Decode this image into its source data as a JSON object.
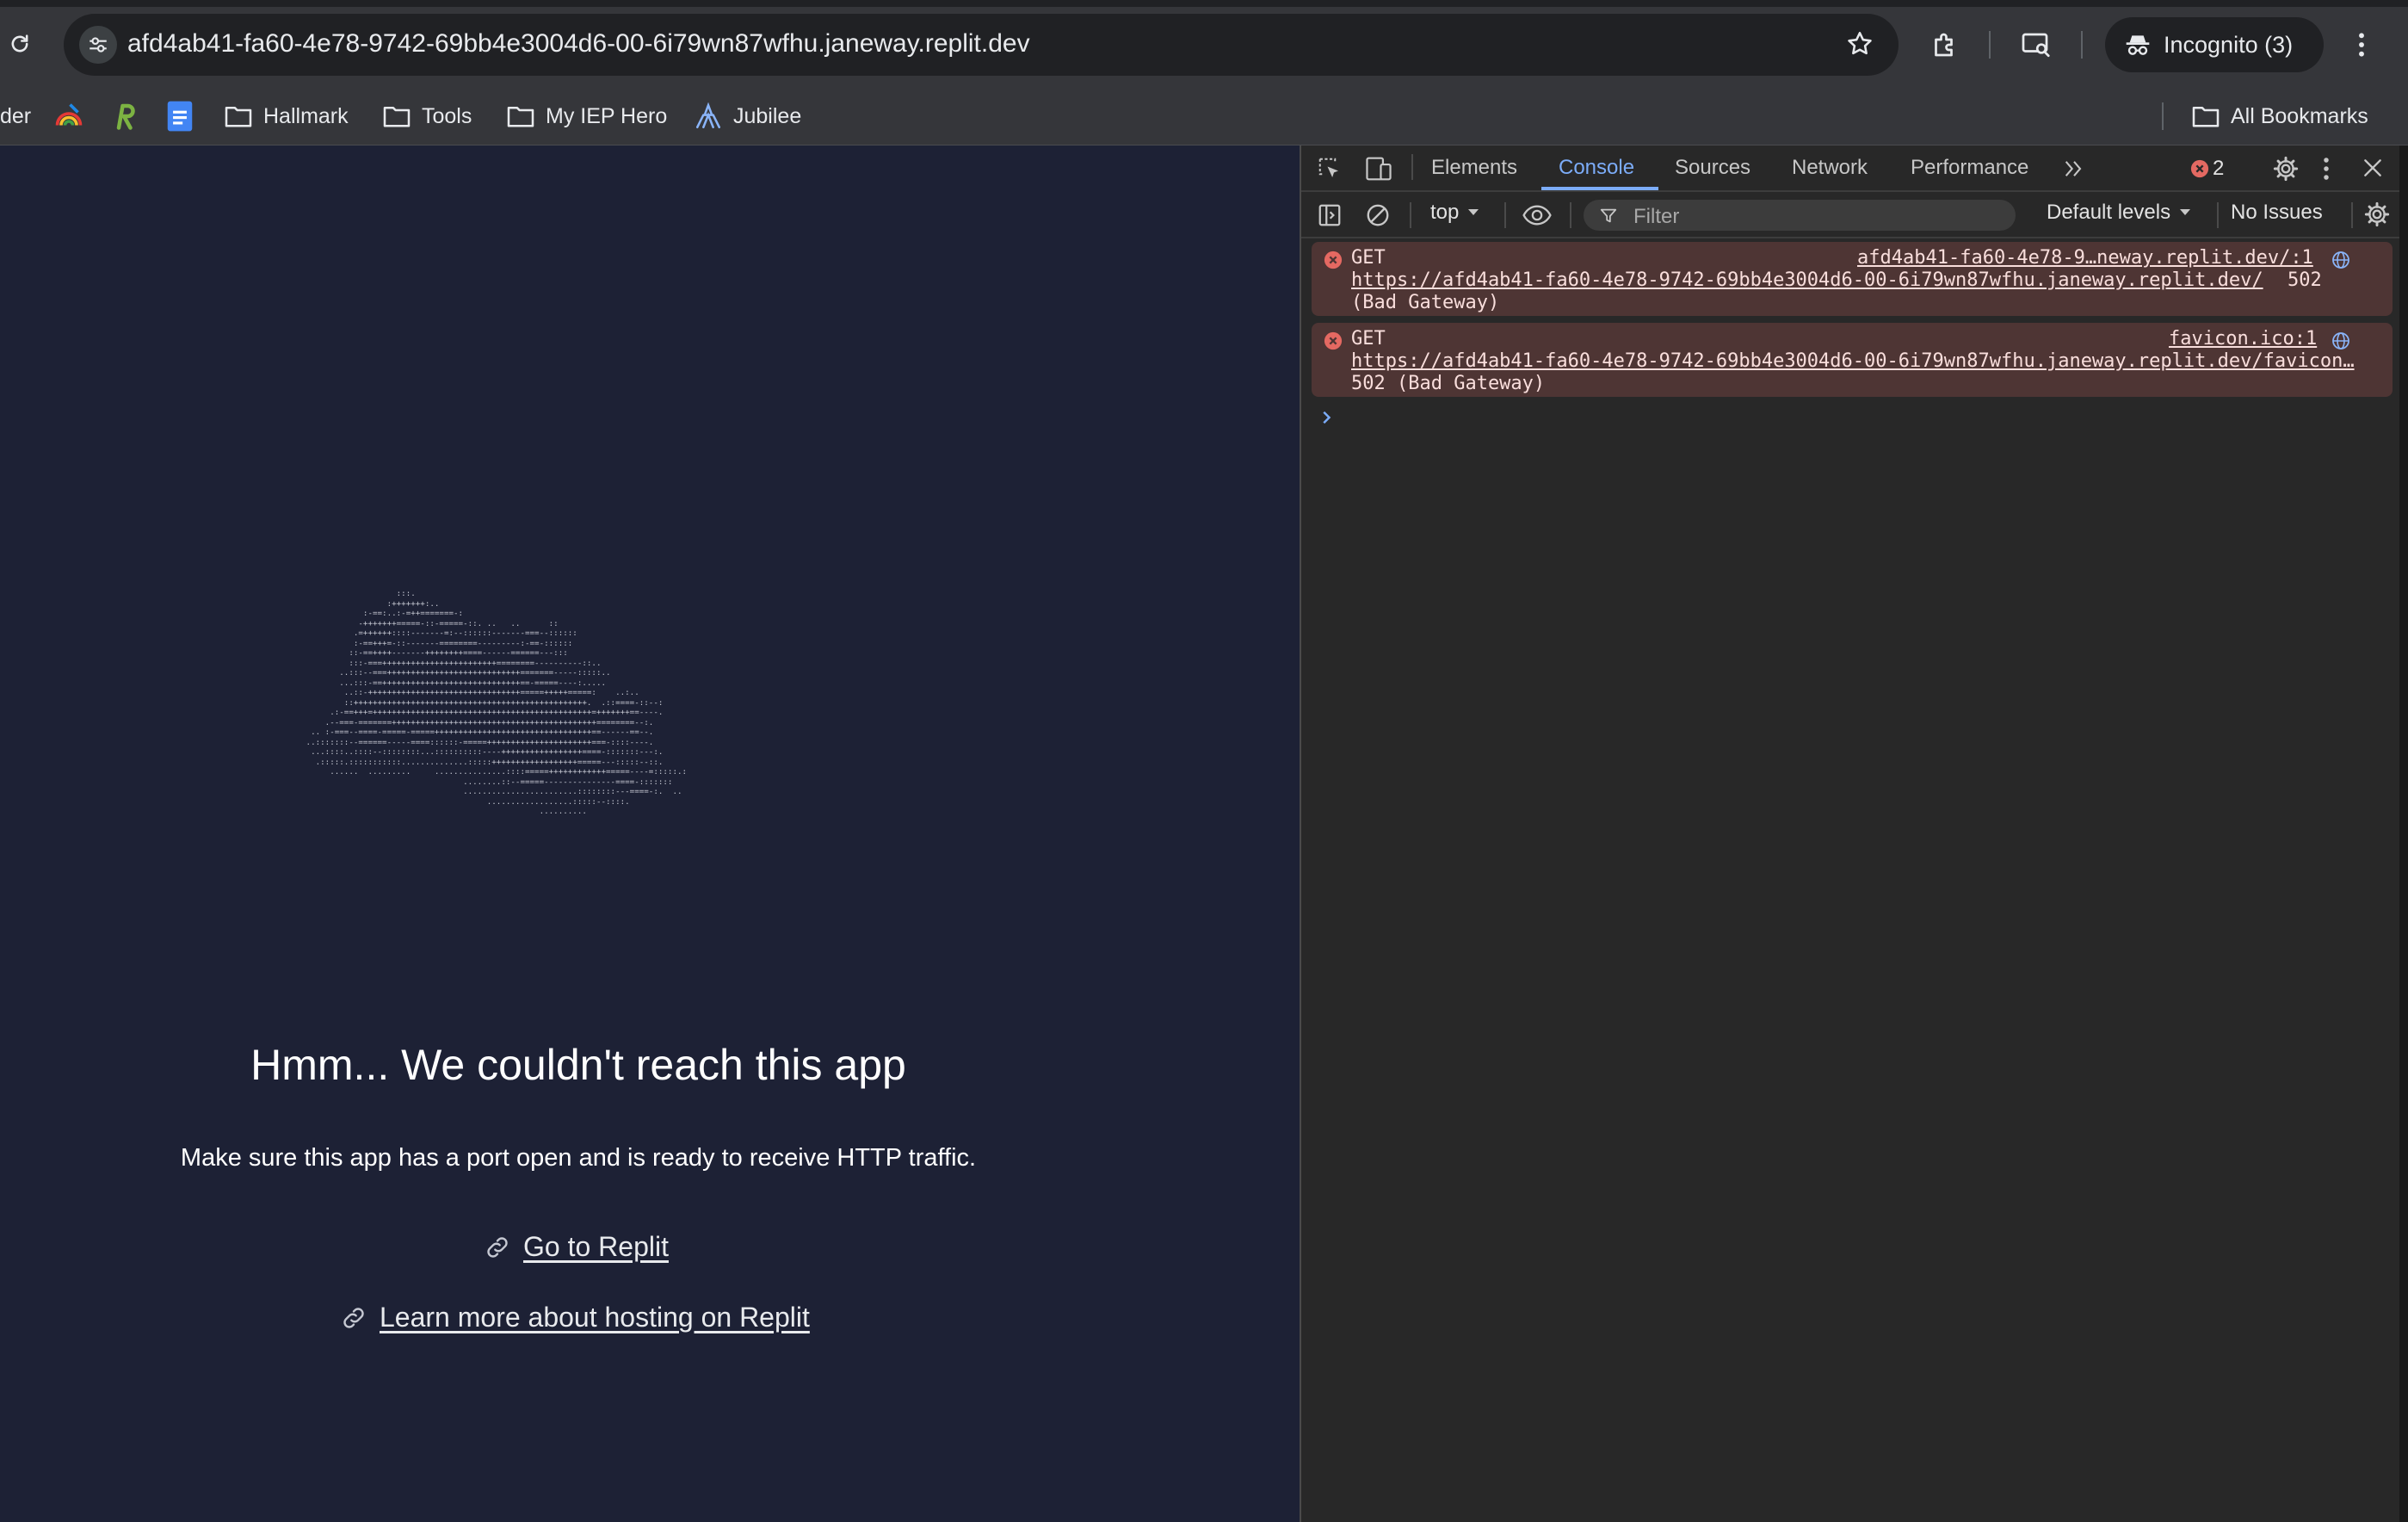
{
  "browser": {
    "url": "afd4ab41-fa60-4e78-9742-69bb4e3004d6-00-6i79wn87wfhu.janeway.replit.dev",
    "incognito_label": "Incognito (3)",
    "bookmarks": {
      "partial": "der",
      "items": [
        {
          "label": "Hallmark",
          "icon": "folder-icon"
        },
        {
          "label": "Tools",
          "icon": "folder-icon"
        },
        {
          "label": "My IEP Hero",
          "icon": "folder-icon"
        },
        {
          "label": "Jubilee",
          "icon": "jubilee-logo-icon"
        }
      ],
      "all_bookmarks": "All Bookmarks"
    }
  },
  "page": {
    "ascii_art": "                    :::.\n                  :+++++++:..\n             :-==:..:-=++=======-:\n            -+++++++=====-::-=====-::. ..   ..      ::\n           .=++++++::::-------=:--::::::-------===--::::::\n           :-==+++=-::-------========---------:-==-::::::\n          ::-==++++-------++++++++====------======---:::\n          :::-===++++++++++++++++++++++++========----------::..\n        ..:::--===++++++++++++++++++++++++++++=======-----:::::..\n        ...:::-==+++++++++++++++++++++++++++++==-=====----:.....\n         ..::-++++++++++++++++++++++++++++++++=====+++++=====:    ..:..\n         ::+++++++++++++++++++++++++++++++++++++++++++++++++.  .::====-::--:\n      .:-==+++=++++++++++++++++++++++++++++++++++++++++++++++=+++++++==----.\n     .--===-=======+++++++++++++++++++++++++++++++++++++++++++========--:.\n  .. :-===--====-=====-=====+++++++++++++++++++++++++++++++++==------==--.\n ..:::::::--======-----====::::::-=====++++++++++++++++++++++===-::::----.\n  ...::::..::::--::::::::...::::::::::----+++++++++++++++++====-:::::::---:.\n   .:::::.:::::::::::..............:::::++++++++++++++++++=====---:::::--::.\n      ......  .........     ...............::::=====++++++++++++=====----=:::::.:\n                                  ........::--=====---------------====-:::::::\n                                  ........................::::::::---====-:.  ..\n                                       ..................:::::--::::.\n                                                  .........."
  },
  "error": {
    "headline": "Hmm... We couldn't reach this app",
    "message": "Make sure this app has a port open and is ready to receive HTTP traffic.",
    "links": [
      "Go to Replit",
      "Learn more about hosting on Replit"
    ]
  },
  "devtools": {
    "tabs": [
      "Elements",
      "Console",
      "Sources",
      "Network",
      "Performance"
    ],
    "active_tab": "Console",
    "error_count": "2",
    "context": "top",
    "filter_placeholder": "Filter",
    "levels": "Default levels",
    "issues": "No Issues",
    "messages": [
      {
        "method": "GET",
        "source": "afd4ab41-fa60-4e78-9…neway.replit.dev/:1",
        "url": "https://afd4ab41-fa60-4e78-9742-69bb4e3004d6-00-6i79wn87wfhu.janeway.replit.dev/",
        "status_inline": "502",
        "status_next": "(Bad Gateway)"
      },
      {
        "method": "GET",
        "source": "favicon.ico:1",
        "url": "https://afd4ab41-fa60-4e78-9742-69bb4e3004d6-00-6i79wn87wfhu.janeway.replit.dev/favicon…",
        "status_next": "502 (Bad Gateway)"
      }
    ]
  },
  "colors": {
    "page_bg": "#1d2135",
    "devtools_bg": "#282828",
    "accent": "#7cacf8",
    "error_bg": "#4e3534",
    "error_icon": "#e46962"
  }
}
